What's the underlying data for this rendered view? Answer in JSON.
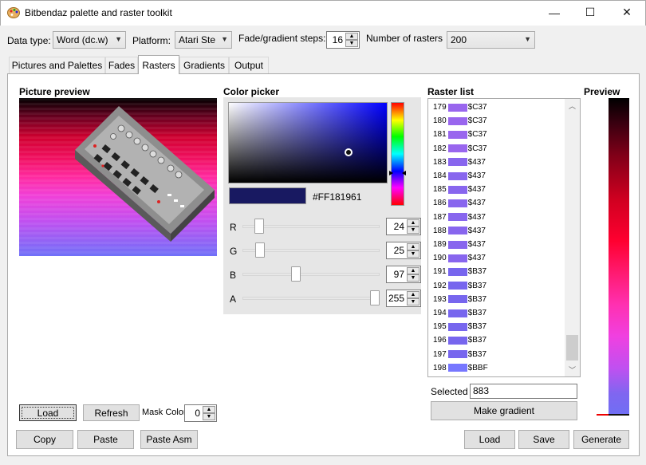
{
  "window": {
    "title": "Bitbendaz palette and raster toolkit",
    "minimize": "—",
    "maximize": "☐",
    "close": "✕"
  },
  "toolbar": {
    "data_type_label": "Data type:",
    "data_type_value": "Word (dc.w)",
    "platform_label": "Platform:",
    "platform_value": "Atari Ste",
    "fade_label": "Fade/gradient steps:",
    "fade_value": "16",
    "rasters_label": "Number of rasters",
    "rasters_value": "200"
  },
  "tabs": [
    {
      "label": "Pictures and Palettes",
      "active": false
    },
    {
      "label": "Fades",
      "active": false
    },
    {
      "label": "Rasters",
      "active": true
    },
    {
      "label": "Gradients",
      "active": false
    },
    {
      "label": "Output",
      "active": false
    }
  ],
  "picture_preview": {
    "heading": "Picture preview",
    "load_label": "Load",
    "refresh_label": "Refresh",
    "mask_color_label": "Mask Color",
    "mask_color_value": "0"
  },
  "color_picker": {
    "heading": "Color picker",
    "hex": "#FF181961",
    "selected_color": "#181961",
    "channels": [
      {
        "name": "R",
        "value": "24",
        "level": 0.094
      },
      {
        "name": "G",
        "value": "25",
        "level": 0.098
      },
      {
        "name": "B",
        "value": "97",
        "level": 0.38
      },
      {
        "name": "A",
        "value": "255",
        "level": 1.0
      }
    ]
  },
  "raster_list": {
    "heading": "Raster list",
    "items": [
      {
        "index": "179",
        "code": "$C37",
        "color": "#9966ee"
      },
      {
        "index": "180",
        "code": "$C37",
        "color": "#9966ee"
      },
      {
        "index": "181",
        "code": "$C37",
        "color": "#9966ee"
      },
      {
        "index": "182",
        "code": "$C37",
        "color": "#9966ee"
      },
      {
        "index": "183",
        "code": "$437",
        "color": "#8866ee"
      },
      {
        "index": "184",
        "code": "$437",
        "color": "#8866ee"
      },
      {
        "index": "185",
        "code": "$437",
        "color": "#8866ee"
      },
      {
        "index": "186",
        "code": "$437",
        "color": "#8866ee"
      },
      {
        "index": "187",
        "code": "$437",
        "color": "#8866ee"
      },
      {
        "index": "188",
        "code": "$437",
        "color": "#8866ee"
      },
      {
        "index": "189",
        "code": "$437",
        "color": "#8866ee"
      },
      {
        "index": "190",
        "code": "$437",
        "color": "#8866ee"
      },
      {
        "index": "191",
        "code": "$B37",
        "color": "#7766ee"
      },
      {
        "index": "192",
        "code": "$B37",
        "color": "#7766ee"
      },
      {
        "index": "193",
        "code": "$B37",
        "color": "#7766ee"
      },
      {
        "index": "194",
        "code": "$B37",
        "color": "#7766ee"
      },
      {
        "index": "195",
        "code": "$B37",
        "color": "#7766ee"
      },
      {
        "index": "196",
        "code": "$B37",
        "color": "#7766ee"
      },
      {
        "index": "197",
        "code": "$B37",
        "color": "#7766ee"
      },
      {
        "index": "198",
        "code": "$BBF",
        "color": "#7777ff"
      }
    ],
    "selected_label": "Selected",
    "selected_value": "883",
    "make_gradient_label": "Make gradient"
  },
  "preview": {
    "heading": "Preview"
  },
  "footer": {
    "copy_label": "Copy",
    "paste_label": "Paste",
    "paste_asm_label": "Paste Asm",
    "load_label": "Load",
    "save_label": "Save",
    "generate_label": "Generate"
  }
}
